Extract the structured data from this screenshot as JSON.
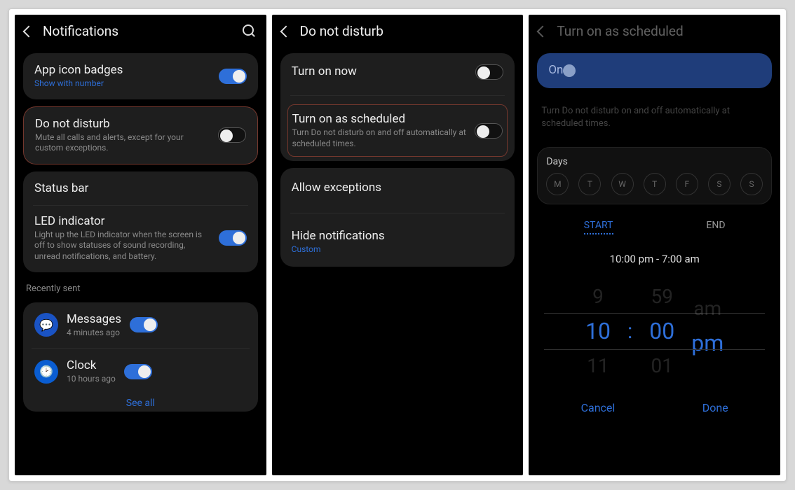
{
  "screen1": {
    "title": "Notifications",
    "badges": {
      "title": "App icon badges",
      "sub": "Show with number",
      "on": true
    },
    "dnd": {
      "title": "Do not disturb",
      "sub": "Mute all calls and alerts, except for your custom exceptions.",
      "on": false
    },
    "statusbar": "Status bar",
    "led": {
      "title": "LED indicator",
      "sub": "Light up the LED indicator when the screen is off to show statuses of sound recording, unread notifications, and battery.",
      "on": true
    },
    "recently": "Recently sent",
    "apps": [
      {
        "name": "Messages",
        "sub": "4 minutes ago",
        "on": true
      },
      {
        "name": "Clock",
        "sub": "10 hours ago",
        "on": true
      }
    ],
    "seeall": "See all"
  },
  "screen2": {
    "title": "Do not disturb",
    "now": {
      "title": "Turn on now",
      "on": false
    },
    "sched": {
      "title": "Turn on as scheduled",
      "sub": "Turn Do not disturb on and off automatically at scheduled times.",
      "on": false
    },
    "exc": "Allow exceptions",
    "hide": {
      "title": "Hide notifications",
      "sub": "Custom"
    }
  },
  "screen3": {
    "title": "Turn on as scheduled",
    "onlabel": "On",
    "dimtext": "Turn Do not disturb on and off automatically at scheduled times.",
    "dayslabel": "Days",
    "days": [
      "M",
      "T",
      "W",
      "T",
      "F",
      "S",
      "S"
    ],
    "tabs": {
      "start": "START",
      "end": "END"
    },
    "summary": "10:00  pm   -   7:00  am",
    "picker": {
      "hUp": "9",
      "h": "10",
      "hDn": "11",
      "mUp": "59",
      "m": "00",
      "mDn": "01",
      "aUp": "am",
      "a": "pm",
      "aDn": ""
    },
    "cancel": "Cancel",
    "done": "Done"
  }
}
